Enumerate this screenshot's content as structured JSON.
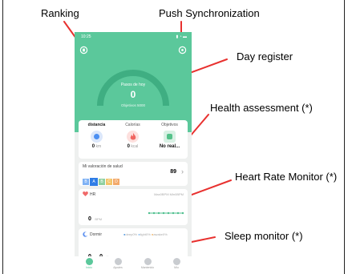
{
  "callouts": {
    "ranking": "Ranking",
    "push_sync": "Push Synchronization",
    "day_register": "Day register",
    "health_assessment": "Health assessment (*)",
    "heart_rate_monitor": "Heart Rate Monitor (*)",
    "sleep_monitor": "Sleep monitor (*)"
  },
  "status_bar": {
    "time": "10:25",
    "icons": "▮ ◔ ▬"
  },
  "steps": {
    "title": "Pasos de hoy",
    "value": "0",
    "goal": "Objetivos 5000"
  },
  "stats": {
    "tabs": [
      "distancia",
      "Calorías",
      "Objetivos"
    ],
    "distance": {
      "value": "0",
      "unit": "km"
    },
    "calories": {
      "value": "0",
      "unit": "kcal"
    },
    "goals": {
      "value": "No real..."
    }
  },
  "health": {
    "label": "Mi valoración de salud",
    "score": "89",
    "chevron": "›",
    "letters": [
      "B",
      "A",
      "B",
      "C",
      "D"
    ]
  },
  "heart_rate": {
    "label": "HR",
    "range": "Max0BPM  Min0BPM",
    "value": "0",
    "unit": "BPM"
  },
  "sleep": {
    "label": "Dormir",
    "legend": [
      "deep0%",
      "light0%",
      "awake0%"
    ],
    "value": "0",
    "separator": "0",
    "unit": "H"
  },
  "nav": [
    "Inicio",
    "Ajustes",
    "Mantenido",
    "Mío"
  ],
  "colors": {
    "brand": "#5bc89b",
    "distance": "#4b8ff2",
    "calories": "#f06560",
    "goals": "#55c28a",
    "heart": "#f06a6a",
    "sleep": "#5b8ff0"
  }
}
